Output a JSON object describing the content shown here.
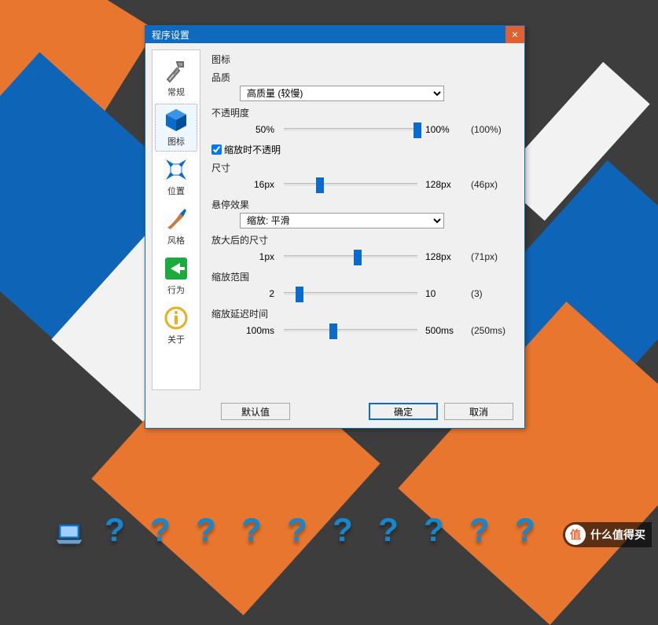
{
  "dialog": {
    "title": "程序设置",
    "sidebar": [
      {
        "id": "general",
        "label": "常规"
      },
      {
        "id": "icons",
        "label": "图标"
      },
      {
        "id": "position",
        "label": "位置"
      },
      {
        "id": "style",
        "label": "风格"
      },
      {
        "id": "behavior",
        "label": "行为"
      },
      {
        "id": "about",
        "label": "关于"
      }
    ],
    "active_tab": "icons",
    "section_heading": "图标",
    "quality": {
      "label": "品质",
      "selected": "高质量 (较慢)"
    },
    "opacity": {
      "label": "不透明度",
      "min": "50%",
      "max": "100%",
      "current": "(100%)",
      "pct": 100
    },
    "zoom_opaque": {
      "label": "缩放时不透明",
      "checked": true
    },
    "size": {
      "label": "尺寸",
      "min": "16px",
      "max": "128px",
      "current": "(46px)",
      "pct": 27
    },
    "hover_effect": {
      "label": "悬停效果",
      "selected": "缩放: 平滑"
    },
    "zoom_size": {
      "label": "放大后的尺寸",
      "min": "1px",
      "max": "128px",
      "current": "(71px)",
      "pct": 55
    },
    "zoom_range": {
      "label": "缩放范围",
      "min": "2",
      "max": "10",
      "current": "(3)",
      "pct": 12
    },
    "zoom_delay": {
      "label": "缩放延迟时间",
      "min": "100ms",
      "max": "500ms",
      "current": "(250ms)",
      "pct": 37
    },
    "buttons": {
      "defaults": "默认值",
      "ok": "确定",
      "cancel": "取消"
    }
  },
  "watermark": {
    "badge": "值",
    "text": "什么值得买"
  }
}
